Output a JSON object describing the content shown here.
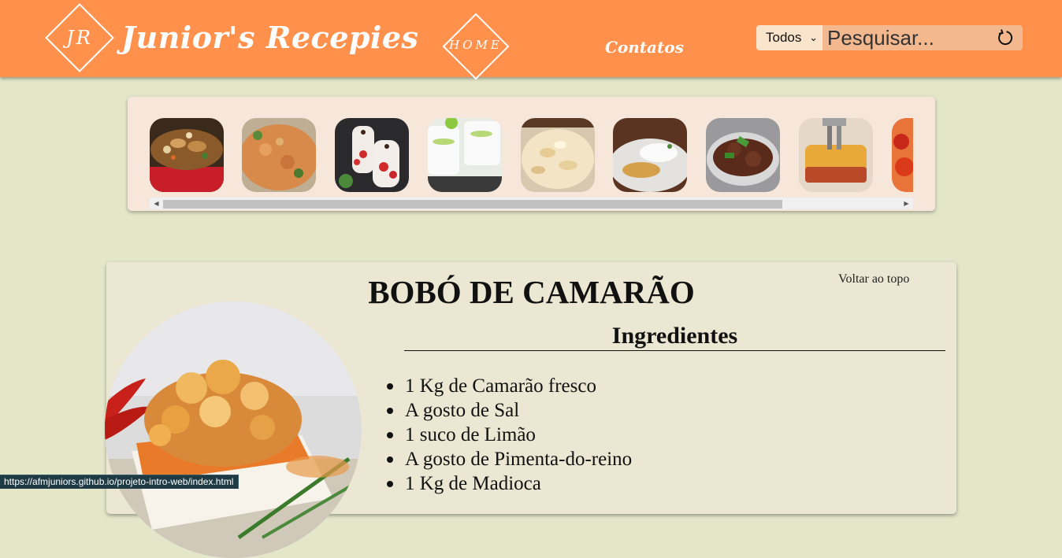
{
  "header": {
    "logo_monogram": "JR",
    "brand_name": "Junior's Recepies",
    "nav_home": "HOME",
    "nav_contatos": "Contatos",
    "search_category": "Todos",
    "search_placeholder": "Pesquisar..."
  },
  "carousel": {
    "items": [
      {
        "icon": "stir-fry-noodles-photo"
      },
      {
        "icon": "rice-dish-photo"
      },
      {
        "icon": "strawberry-dessert-cups-photo"
      },
      {
        "icon": "lime-mousse-cups-photo"
      },
      {
        "icon": "creamy-pasta-photo"
      },
      {
        "icon": "breaded-fish-rice-photo"
      },
      {
        "icon": "meat-stew-photo"
      },
      {
        "icon": "lasagna-photo"
      },
      {
        "icon": "tomato-dish-photo"
      }
    ]
  },
  "recipe": {
    "title": "BOBÓ DE CAMARÃO",
    "back_to_top": "Voltar ao topo",
    "ingredients_heading": "Ingredientes",
    "ingredients": [
      "1 Kg de Camarão fresco",
      "A gosto de Sal",
      "1 suco de Limão",
      "A gosto de Pimenta-do-reino",
      "1 Kg de Madioca"
    ]
  },
  "status_bar": {
    "url": "https://afmjuniors.github.io/projeto-intro-web/index.html"
  },
  "colors": {
    "header": "#ff914d",
    "page_background": "#e4e6c9",
    "card_background": "#ebe7d2",
    "carousel_background": "#f7e6da"
  }
}
